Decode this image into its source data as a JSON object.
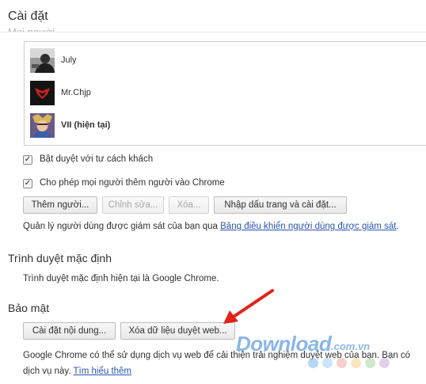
{
  "header": {
    "title": "Cài đặt",
    "faded_heading": "Mọi người"
  },
  "people": {
    "profiles": [
      {
        "name": "July",
        "current": false
      },
      {
        "name": "Mr.Chjp",
        "current": false
      },
      {
        "name": "VII (hiện tại)",
        "current": true
      }
    ],
    "guest_browsing_label": "Bật duyệt với tư cách khách",
    "guest_browsing_checked": true,
    "allow_add_person_label": "Cho phép mọi người thêm người vào Chrome",
    "allow_add_person_checked": true,
    "buttons": {
      "add_person": "Thêm người...",
      "edit": "Chỉnh sửa...",
      "remove": "Xóa...",
      "import": "Nhập dấu trang và cài đặt..."
    },
    "supervised_text": "Quản lý người dùng được giám sát của bạn qua",
    "supervised_link": "Bảng điều khiển người dùng được giám sát",
    "supervised_end": "."
  },
  "default_browser": {
    "title": "Trình duyệt mặc định",
    "text": "Trình duyệt mặc định hiện tại là Google Chrome."
  },
  "privacy": {
    "title": "Bảo mật",
    "content_settings_button": "Cài đặt nội dung...",
    "clear_data_button": "Xóa dữ liệu duyệt web...",
    "text_line1": "Google Chrome có thể sử dụng dịch vụ web để cải thiện trải nghiệm duyệt web của bạn. Bạn có",
    "text_line2": "dịch vụ này.",
    "learn_more": "Tìm hiểu thêm"
  },
  "watermark": {
    "brand": "Download",
    "suffix": ".com.vn",
    "dot_colors": [
      "#7bb6e8",
      "#9ed0f0",
      "#f2a6a6",
      "#f5d28a",
      "#a8d8a0",
      "#c9a8e0"
    ]
  },
  "colors": {
    "link": "#2a54b0",
    "arrow": "#e2231a"
  }
}
